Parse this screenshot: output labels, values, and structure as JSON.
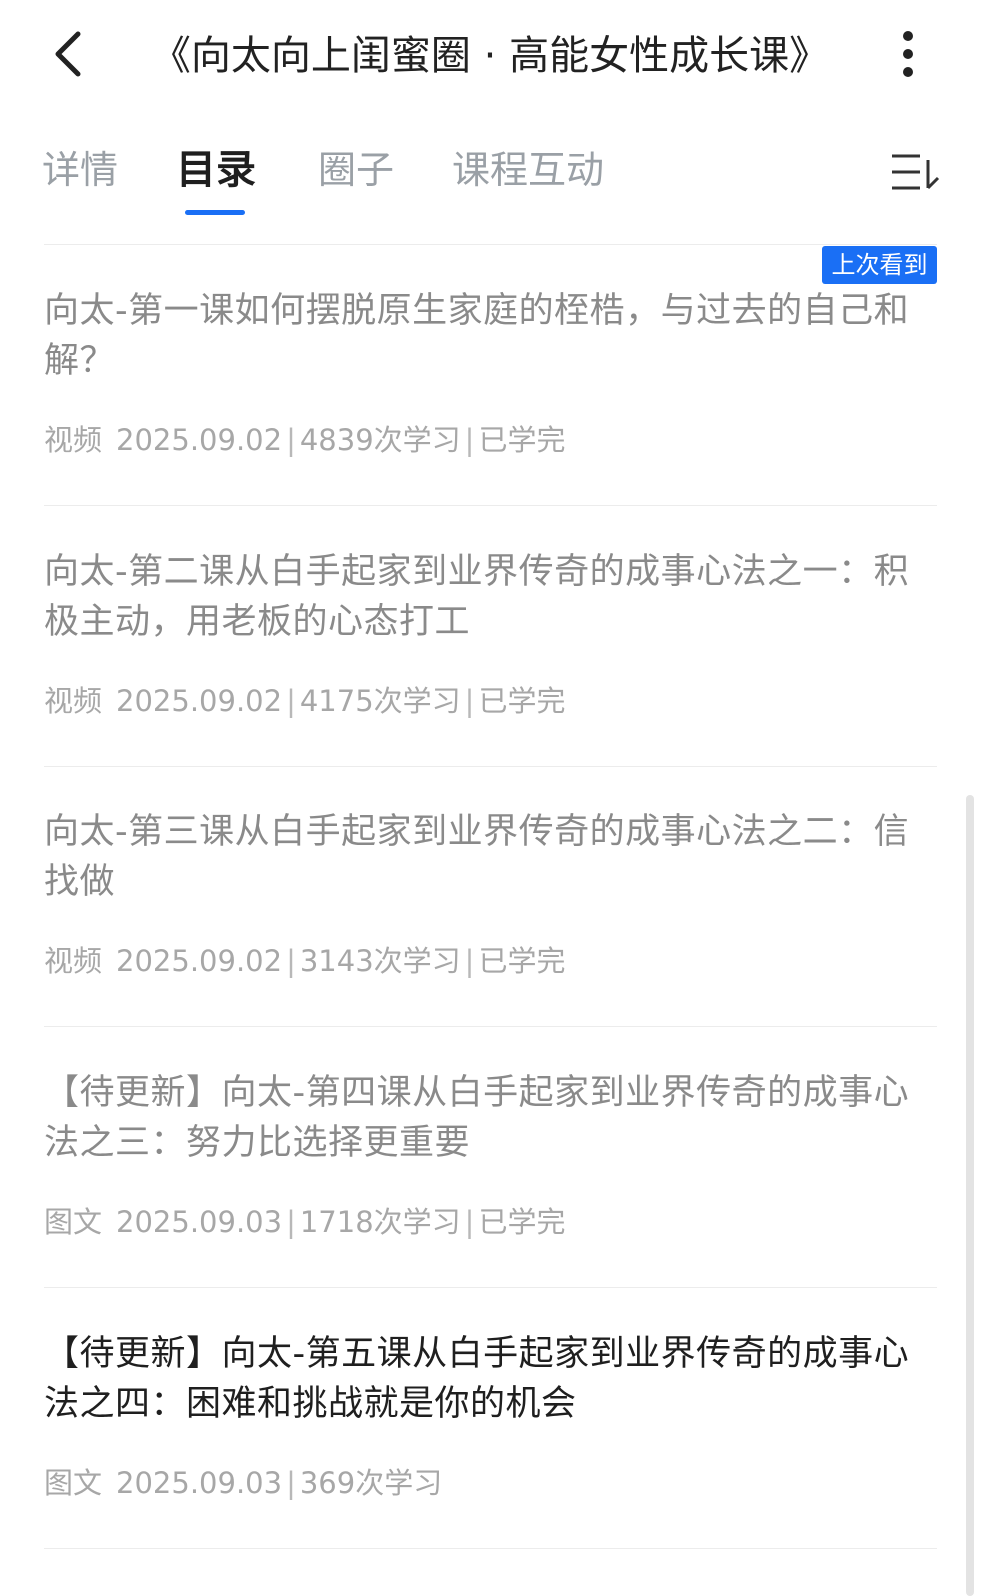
{
  "header": {
    "title": "《向太向上闺蜜圈 · 高能女性成长课》",
    "back_icon": "chevron-left-icon",
    "more_icon": "vertical-dots-icon"
  },
  "tabs": [
    {
      "label": "详情",
      "active": false
    },
    {
      "label": "目录",
      "active": true
    },
    {
      "label": "圈子",
      "active": false
    },
    {
      "label": "课程互动",
      "active": false
    }
  ],
  "tab_menu_icon": "sort-list-icon",
  "accent_color": "#1a6ff5",
  "last_watched_badge": "上次看到",
  "lessons": [
    {
      "title": "向太-第一课如何摆脱原生家庭的桎梏，与过去的自己和解？",
      "type": "视频",
      "date": "2025.09.02",
      "views": "4839次学习",
      "status": "已学完"
    },
    {
      "title": "向太-第二课从白手起家到业界传奇的成事心法之一：积极主动，用老板的心态打工",
      "type": "视频",
      "date": "2025.09.02",
      "views": "4175次学习",
      "status": "已学完"
    },
    {
      "title": "向太-第三课从白手起家到业界传奇的成事心法之二：信找做",
      "type": "视频",
      "date": "2025.09.02",
      "views": "3143次学习",
      "status": "已学完"
    },
    {
      "title": "【待更新】向太-第四课从白手起家到业界传奇的成事心法之三：努力比选择更重要",
      "type": "图文",
      "date": "2025.09.03",
      "views": "1718次学习",
      "status": "已学完"
    },
    {
      "title": "【待更新】向太-第五课从白手起家到业界传奇的成事心法之四：困难和挑战就是你的机会",
      "type": "图文",
      "date": "2025.09.03",
      "views": "369次学习",
      "status": ""
    }
  ]
}
